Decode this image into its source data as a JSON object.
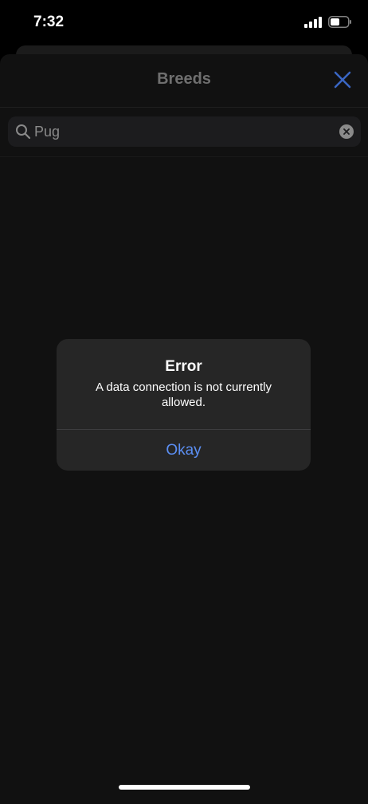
{
  "status_bar": {
    "time": "7:32",
    "icons": [
      "cellular-signal-icon",
      "battery-icon"
    ]
  },
  "nav": {
    "title": "Breeds",
    "close_icon": "close-icon"
  },
  "search": {
    "value": "Pug",
    "icon": "search-icon",
    "clear_icon": "clear-icon"
  },
  "alert": {
    "title": "Error",
    "message": "A data connection is not currently allowed.",
    "button_label": "Okay"
  },
  "colors": {
    "accent": "#5b8ef2",
    "nav_close": "#3a66c4",
    "sheet_bg": "#111111",
    "alert_bg": "#262626"
  }
}
